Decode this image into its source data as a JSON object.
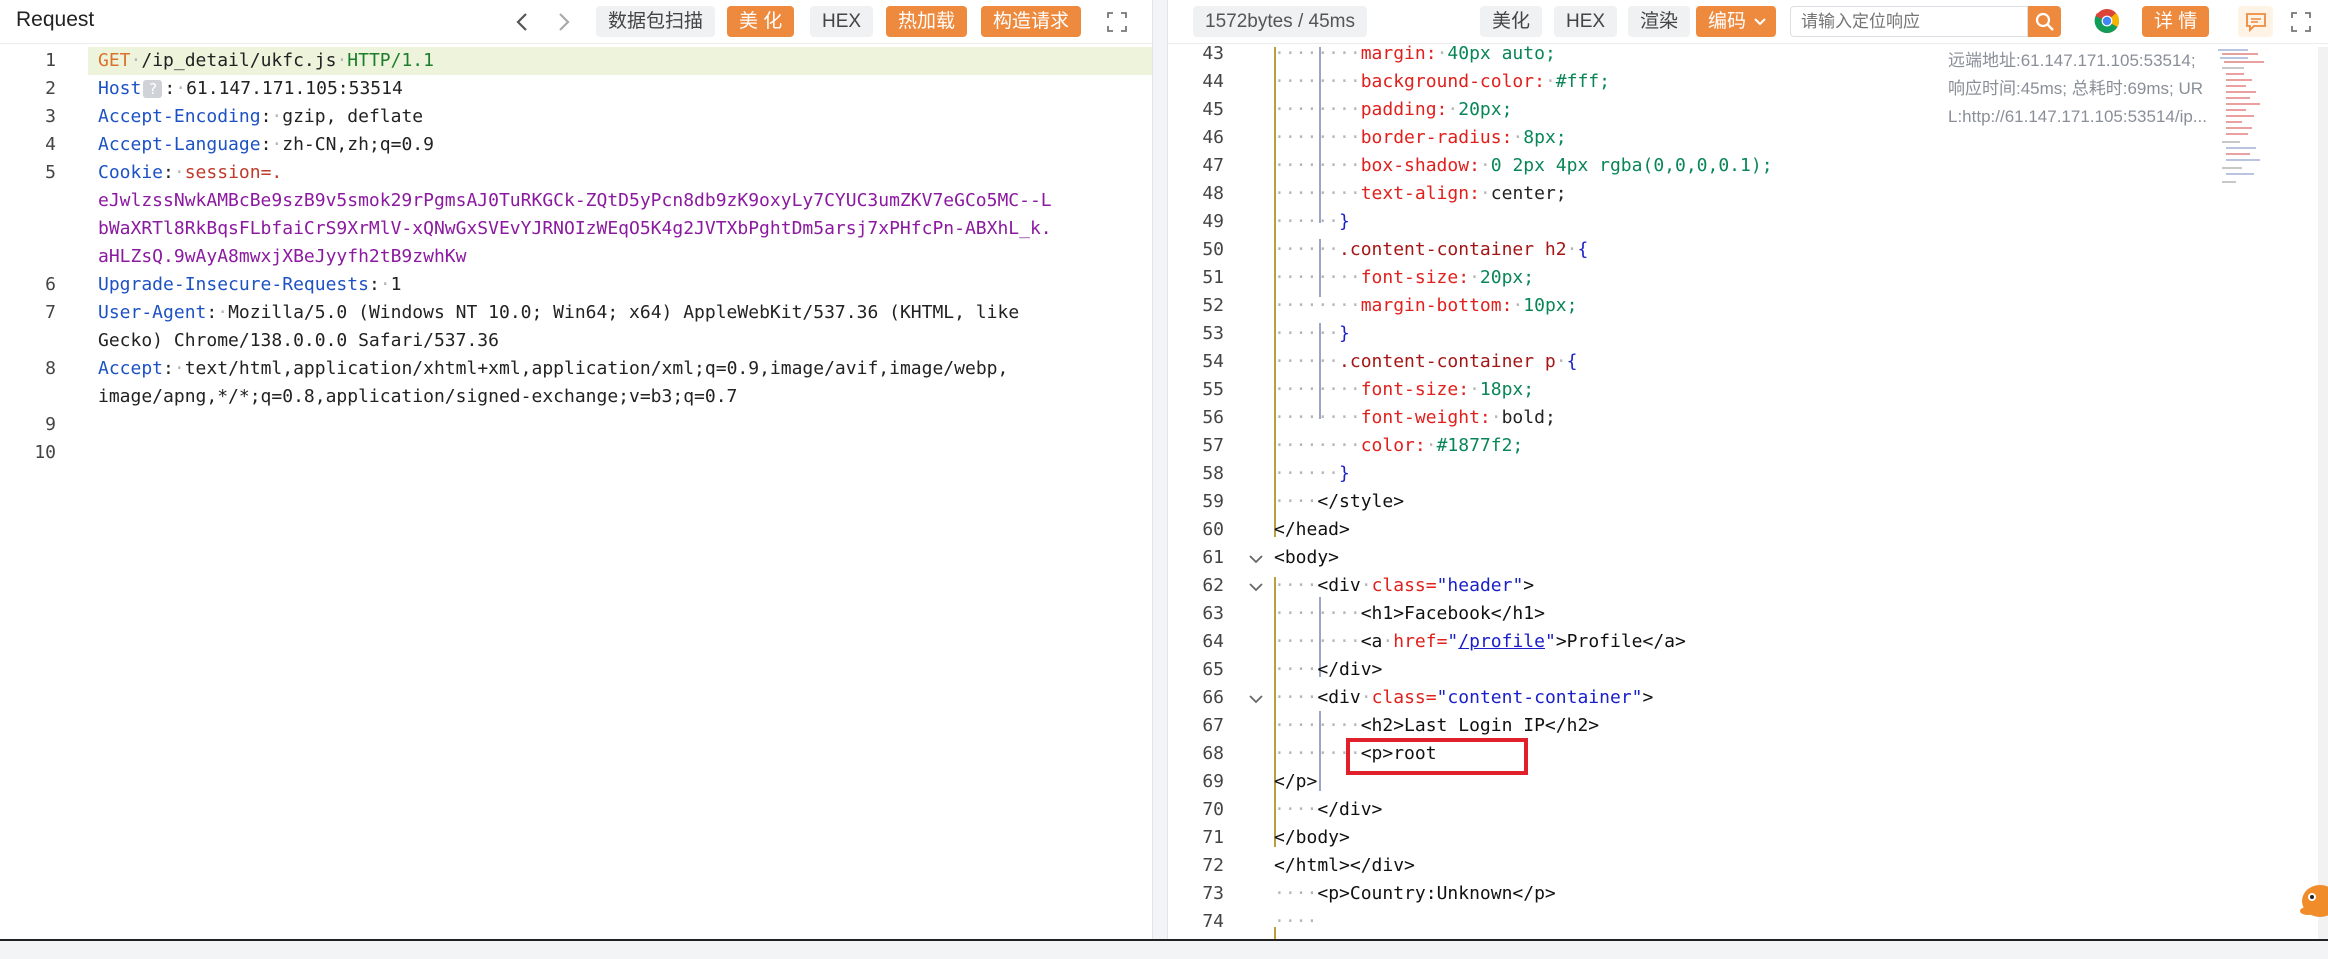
{
  "request": {
    "title": "Request",
    "toolbar": {
      "scan": "数据包扫描",
      "beautify": "美 化",
      "hex": "HEX",
      "hot_load": "热加载",
      "build": "构造请求"
    },
    "lines": [
      {
        "n": "1"
      },
      {
        "n": "2"
      },
      {
        "n": "3"
      },
      {
        "n": "4"
      },
      {
        "n": "5"
      },
      {
        "n": "6"
      },
      {
        "n": "7"
      },
      {
        "n": "8"
      },
      {
        "n": "9"
      },
      {
        "n": "10"
      }
    ],
    "text": {
      "method": "GET",
      "path": "/ip_detail/ukfc.js",
      "proto": "HTTP/1.1",
      "host_key": "Host",
      "host_help": "?",
      "host_val": "61.147.171.105:53514",
      "ae_key": "Accept-Encoding",
      "ae_val": "gzip, deflate",
      "al_key": "Accept-Language",
      "al_val": "zh-CN,zh;q=0.9",
      "cookie_key": "Cookie",
      "cookie_name": "session=.",
      "cookie_1": "eJwlzssNwkAMBcBe9szB9v5smok29rPgmsAJ0TuRKGCk-ZQtD5yPcn8db9zK9oxyLy7CYUC3umZKV7eGCo5MC--L",
      "cookie_2": "bWaXRTl8RkBqsFLbfaiCrS9XrMlV-xQNwGxSVEvYJRNOIzWEqO5K4g2JVTXbPghtDm5arsj7xPHfcPn-ABXhL_k.",
      "cookie_3": "aHLZsQ.9wAyA8mwxjXBeJyyfh2tB9zwhKw",
      "uir_key": "Upgrade-Insecure-Requests",
      "uir_val": "1",
      "ua_key": "User-Agent",
      "ua_val1": "Mozilla/5.0 (Windows NT 10.0; Win64; x64) AppleWebKit/537.36 (KHTML, like",
      "ua_val2": "Gecko) Chrome/138.0.0.0 Safari/537.36",
      "accept_key": "Accept",
      "accept_val1": "text/html,application/xhtml+xml,application/xml;q=0.9,image/avif,image/webp,",
      "accept_val2": "image/apng,*/*;q=0.8,application/signed-exchange;v=b3;q=0.7"
    }
  },
  "response": {
    "stats": "1572bytes / 45ms",
    "toolbar": {
      "beautify": "美化",
      "hex": "HEX",
      "render": "渲染",
      "encoding": "编码",
      "search_placeholder": "请输入定位响应",
      "details": "详 情"
    },
    "info": {
      "remote": "远端地址:61.147.171.105:53514;",
      "timing": "响应时间:45ms; 总耗时:69ms; UR",
      "url": "L:http://61.147.171.105:53514/ip..."
    },
    "line_numbers": [
      "43",
      "44",
      "45",
      "46",
      "47",
      "48",
      "49",
      "50",
      "51",
      "52",
      "53",
      "54",
      "55",
      "56",
      "57",
      "58",
      "59",
      "60",
      "61",
      "62",
      "63",
      "64",
      "65",
      "66",
      "67",
      "68",
      "69",
      "70",
      "71",
      "72",
      "73",
      "74"
    ],
    "text": {
      "l43_prop": "margin:",
      "l43_val": "40px auto;",
      "l44_prop": "background-color:",
      "l44_val": "#fff;",
      "l45_prop": "padding:",
      "l45_val": "20px;",
      "l46_prop": "border-radius:",
      "l46_val": "8px;",
      "l47_prop": "box-shadow:",
      "l47_val": "0 2px 4px rgba(0,0,0,0.1);",
      "l48_prop": "text-align:",
      "l48_val": "center;",
      "l49": "}",
      "l50_sel": ".content-container h2",
      "l50_brace": "{",
      "l51_prop": "font-size:",
      "l51_val": "20px;",
      "l52_prop": "margin-bottom:",
      "l52_val": "10px;",
      "l53": "}",
      "l54_sel": ".content-container p",
      "l54_brace": "{",
      "l55_prop": "font-size:",
      "l55_val": "18px;",
      "l56_prop": "font-weight:",
      "l56_val": "bold;",
      "l57_prop": "color:",
      "l57_val": "#1877f2;",
      "l58": "}",
      "l59": "</style>",
      "l60": "</head>",
      "l61": "<body>",
      "l62_a": "<div",
      "l62_attr": "class=",
      "l62_str": "\"header\"",
      "l62_b": ">",
      "l63": "<h1>Facebook</h1>",
      "l64_a": "<a",
      "l64_attr": "href=",
      "l64_q1": "\"",
      "l64_link": "/profile",
      "l64_q2": "\"",
      "l64_b": ">Profile</a>",
      "l65": "</div>",
      "l66_a": "<div",
      "l66_attr": "class=",
      "l66_str": "\"content-container\"",
      "l66_b": ">",
      "l67": "<h2>Last Login IP</h2>",
      "l68": "<p>root",
      "l69": "</p>",
      "l70": "</div>",
      "l71": "</body>",
      "l72": "</html></div>",
      "l73": "<p>Country:Unknown</p>",
      "l74": ""
    }
  },
  "colors": {
    "accent_orange": "#ee8a3e",
    "highlight_box": "#e0202a"
  }
}
